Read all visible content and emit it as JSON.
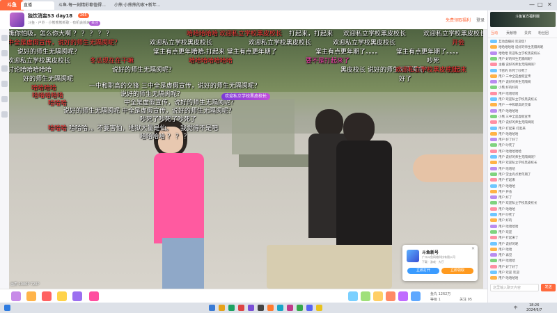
{
  "browser": {
    "logo": "斗鱼",
    "tabs": [
      "直播",
      "斗鱼-每一刻精彩都值得...",
      "小熊·小熊熊的家+新年..."
    ],
    "window_controls": [
      "—",
      "□",
      "✕"
    ]
  },
  "header": {
    "title": "独饮消盅S3 day18",
    "meta": "斗鱼 · 户外 · 小熊熊熊新歌 · 有机会就来",
    "badge_1": "265",
    "badge_2": "关注",
    "right_text_1": "免费领取福利",
    "right_text_2": "登录"
  },
  "danmaku": [
    {
      "text": "你瞧你怕吸，怎么你大啊 ？ ？ ？ ？ ？",
      "color": "white"
    },
    {
      "text": "哈哈哈哈哈",
      "color": "red"
    },
    {
      "text": "欢迎私立学校黑皮校长",
      "color": "red"
    },
    {
      "text": "打起来，打起来",
      "color": "white"
    },
    {
      "text": "欢迎私立学校黑皮校长",
      "color": "white"
    },
    {
      "text": "欢迎私立学校黑皮校长",
      "color": "white"
    },
    {
      "text": "中全是虚假宣传，说好的师生无隔阂呢？",
      "color": "red"
    },
    {
      "text": "欢迎私立学校黑皮校长",
      "color": "white"
    },
    {
      "text": "欢迎私立学校黑皮校长",
      "color": "white"
    },
    {
      "text": "欢迎私立学校黑皮校长",
      "color": "white"
    },
    {
      "text": "开会",
      "color": "red"
    },
    {
      "text": "说好的师生无隔阂呢？",
      "color": "white"
    },
    {
      "text": "堂主有点更年期了。。。。",
      "color": "white"
    },
    {
      "text": "哈哈 打起来 堂主有点更年期了",
      "color": "white"
    },
    {
      "text": "堂主有点更年期了。。。。",
      "color": "white"
    },
    {
      "text": "堂主有点更年期了。。。。",
      "color": "white"
    },
    {
      "text": "欢迎私立学校黑皮校长",
      "color": "white"
    },
    {
      "text": "冬瓜现在在干嘛",
      "color": "red"
    },
    {
      "text": "哈哈哈哈哈哈哈",
      "color": "red"
    },
    {
      "text": "要不是打起来了",
      "color": "pink"
    },
    {
      "text": "讨论哈哈哈哈哈",
      "color": "red"
    },
    {
      "text": "说好的师生无隔阂呢？",
      "color": "white"
    },
    {
      "text": "黑皮校长 说好的师生无隔阂呢？",
      "color": "white"
    },
    {
      "text": "欢迎私立学校黑皮校长",
      "color": "red"
    },
    {
      "text": "好的师生无隔阂呢",
      "color": "white"
    },
    {
      "text": "哈哈哈哈",
      "color": "red"
    },
    {
      "text": "一中和职高的交锋 三中全是虚假宣传，说好的师生无隔阂呢？",
      "color": "white"
    },
    {
      "text": "哈哈哈哈哈",
      "color": "red"
    },
    {
      "text": "说好的师生无隔阂呢？",
      "color": "white"
    },
    {
      "text": "哈哈哈",
      "color": "red"
    },
    {
      "text": "中全是虚假宣传，说好的师生无隔阂呢？",
      "color": "white"
    },
    {
      "text": "说好的师生无隔阂呢 中全是虚假宣传，说好的师生无隔阂呢？",
      "color": "white"
    },
    {
      "text": "吵死了吵死了吵死了",
      "color": "white"
    },
    {
      "text": "哈哈哈",
      "color": "red"
    },
    {
      "text": "哈哈哈。。不要害怕，地狱大量是仙。",
      "color": "white"
    },
    {
      "text": "我觉得不是吧",
      "color": "white"
    },
    {
      "text": "哈哈哈哈  ？ ？ ？",
      "color": "white"
    },
    {
      "text": "吵死",
      "color": "white"
    },
    {
      "text": "打起来",
      "color": "red"
    },
    {
      "text": "好了",
      "color": "white"
    }
  ],
  "video_badge": "欢迎私立学校黑皮校长",
  "video_bottom_text": "画质 1080P  720P",
  "popup": {
    "title": "斗鱼新号",
    "subtitle": "广州斗鱼网络科技有限公司",
    "subtitle_2": "下载 · 游戏 · 大厅",
    "btn_left": "立即打开",
    "btn_right": "立即领取",
    "close": "✕"
  },
  "giftbar": {
    "gift_count_text": "鱼丸 1262万",
    "level_text": "等级 1",
    "follow_text": "关注 95"
  },
  "right_panel": {
    "ad_text": "斗鱼官方福利版",
    "tabs": [
      "互动",
      "贡献榜",
      "贵宾",
      "粉丝团"
    ],
    "chat": [
      "互动直播间 欢迎您！",
      "哈哈哈哈哈 说好的师生无隔阂呢",
      "哈哈哈 欢迎私立学校黑皮校长",
      "用户 好的师生无隔阂呢？",
      "主播 说好的师生无隔阂呢？",
      "卡密的 吵死了吵死了",
      "用户 三中全是虚假宣传",
      "用户 说好的师生无隔阂",
      "小熊 好的好的",
      "用户 哈哈哈哈",
      "用户 欢迎私立学校黑皮校长",
      "用户 一中和职高的交锋",
      "用户 哈哈哈哈",
      "小熊 三中全是虚假宣传",
      "用户 说好的师生无隔阂呢",
      "用户 打起来 打起来",
      "用户 哈哈哈哈",
      "用户 好了好了",
      "用户 吵死了",
      "用户 哈哈哈哈哈",
      "用户 说好的师生无隔阂呢？",
      "用户 欢迎私立学校黑皮校长",
      "用户 哈哈哈",
      "用户 堂主有点更年期了",
      "用户 打起来",
      "用户 哈哈哈",
      "用户 开会",
      "用户 好了",
      "用户 欢迎私立学校黑皮校长",
      "用户 哈哈哈",
      "用户 吵死了",
      "用户 好的",
      "用户 哈哈哈哈",
      "用户 欢迎",
      "用户 打起来了",
      "用户 说好的呢",
      "用户 哈哈",
      "用户 再见",
      "用户 哈哈哈",
      "用户 好了好了",
      "用户 欢迎 欢迎",
      "用户 哈哈哈哈"
    ],
    "input_placeholder": "这里输入聊天内容",
    "send_label": "发送"
  },
  "taskbar": {
    "time": "18:26",
    "date": "2024/6/7",
    "lang": "中"
  },
  "colors": {
    "accent": "#ff6a3d",
    "danmaku_red": "#ff3b3b",
    "danmaku_pink": "#ff3fb1"
  }
}
